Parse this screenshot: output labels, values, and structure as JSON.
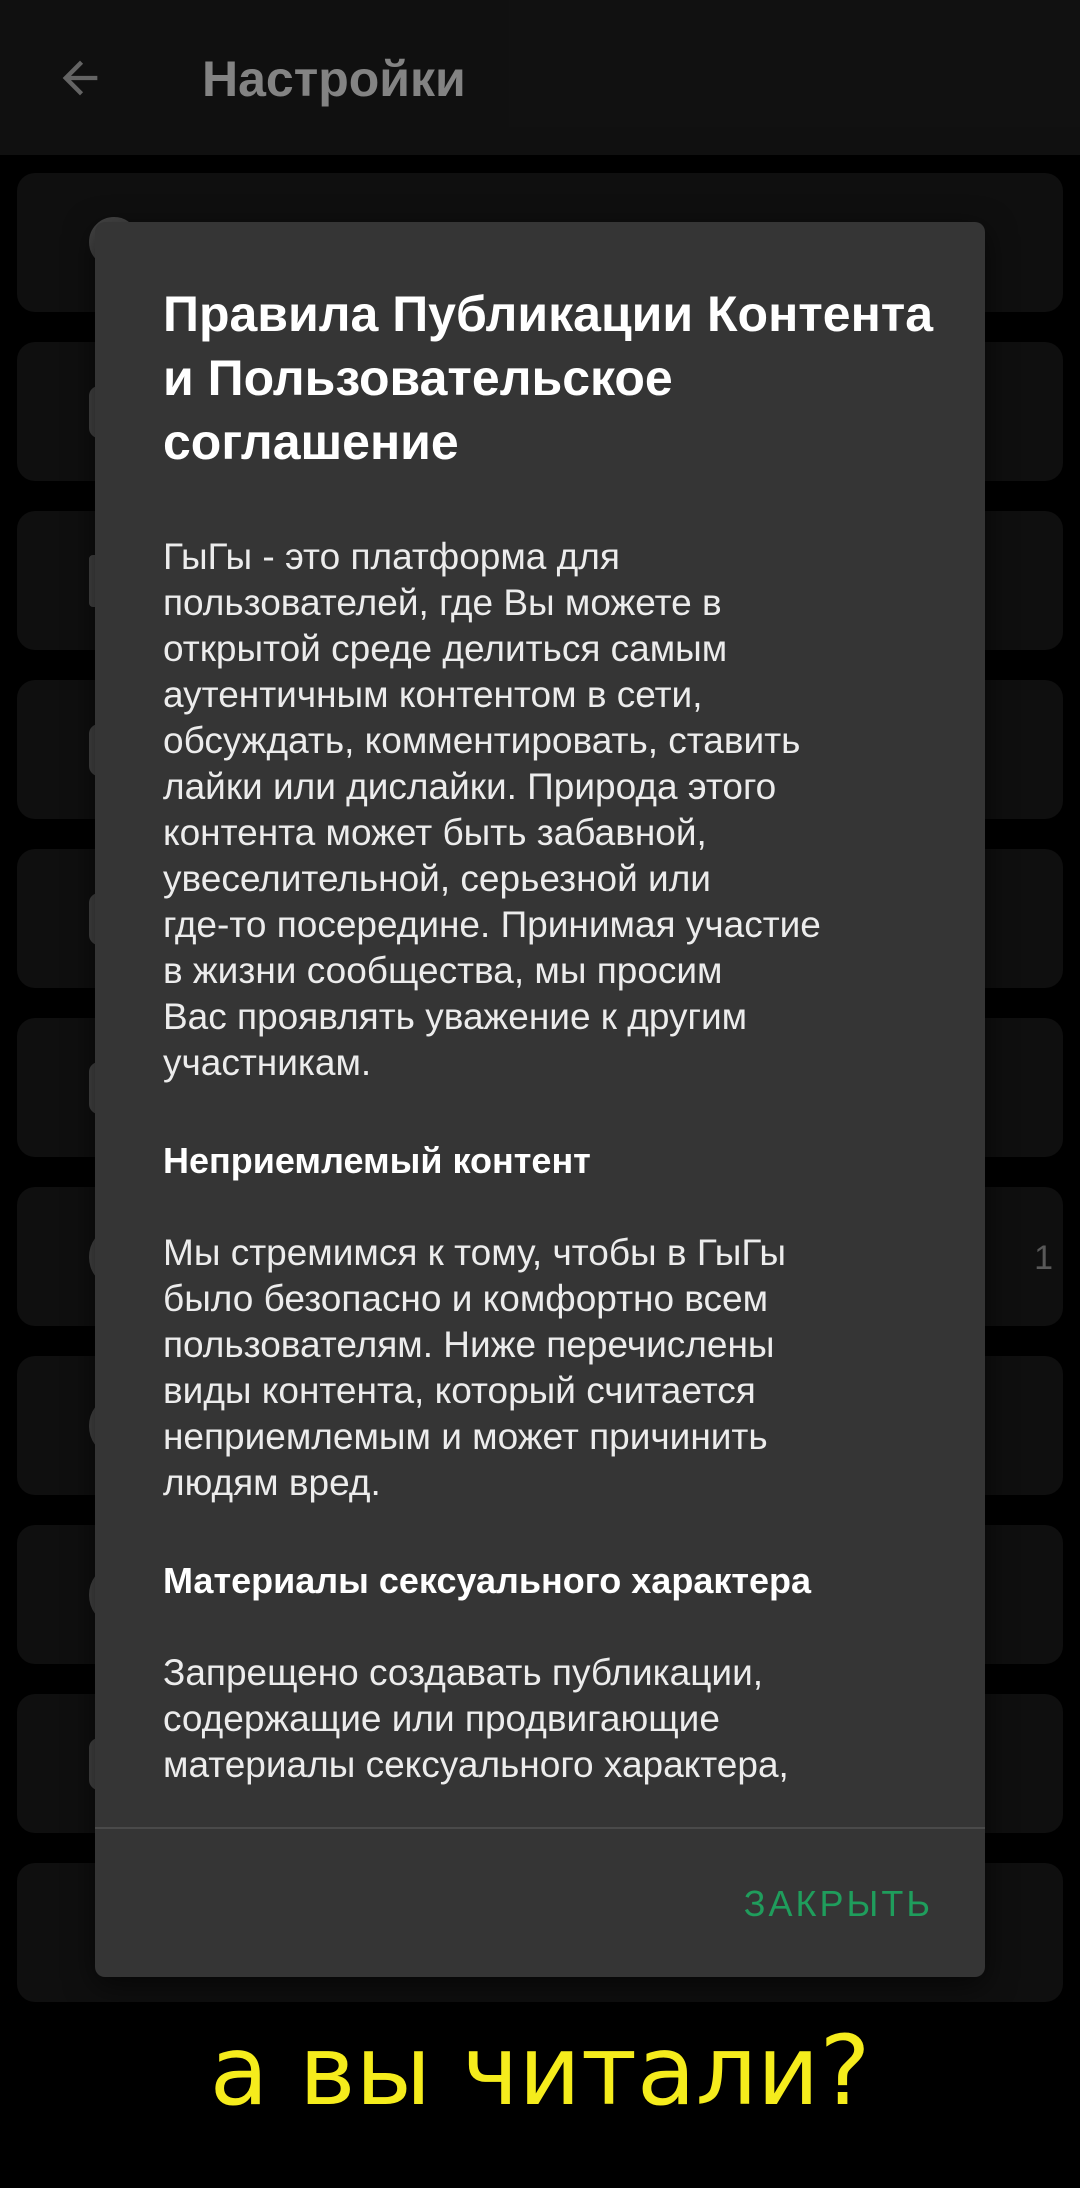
{
  "appbar": {
    "title": "Настройки",
    "back_icon": "arrow-left-icon"
  },
  "settings_rows": {
    "partial_value": "1"
  },
  "dialog": {
    "title": "Правила Публикации Контента и Пользовательское соглашение",
    "intro": "ГыГы - это платформа для\nпользователей, где Вы можете в\nоткрытой среде делиться самым\nаутентичным контентом в сети,\nобсуждать, комментировать, ставить\nлайки или дислайки. Природа этого\nконтента может быть забавной,\nувеселительной, серьезной или\nгде-то посередине. Принимая участие\nв жизни сообщества, мы просим\nВас проявлять уважение к другим\nучастникам.",
    "section1_heading": "Неприемлемый контент",
    "section1_text": "Мы стремимся к тому, чтобы в ГыГы\nбыло безопасно и комфортно всем\nпользователям. Ниже перечислены\nвиды контента, который считается\nнеприемлемым и может причинить\nлюдям вред.",
    "section2_heading": "Материалы сексуального характера",
    "section2_text": "Запрещено создавать публикации,\nсодержащие или продвигающие\nматериалы сексуального характера,",
    "close_label": "ЗАКРЫТЬ"
  },
  "caption": "а вы читали?",
  "colors": {
    "accent": "#1f9d5c",
    "caption": "#f5ec1c",
    "dialog_bg": "#353535"
  }
}
